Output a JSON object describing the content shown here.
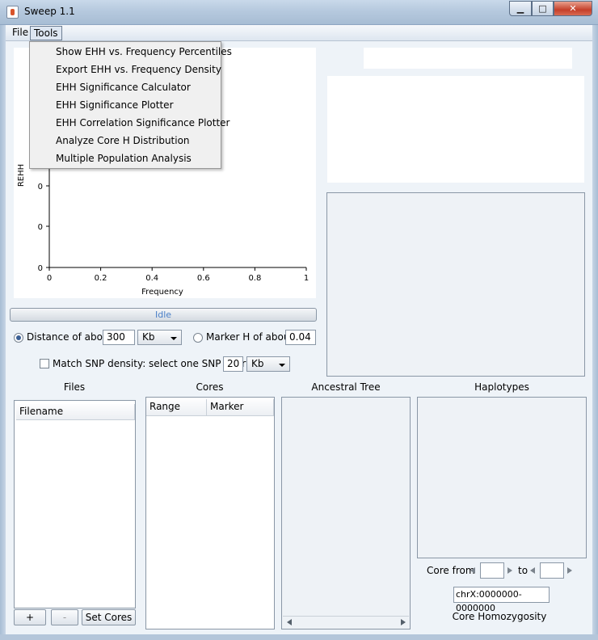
{
  "window": {
    "title": "Sweep 1.1",
    "min": "▁",
    "max": "□",
    "close": "✕"
  },
  "menubar": {
    "file": "File",
    "tools": "Tools"
  },
  "tools_menu": {
    "items": [
      "Show EHH vs. Frequency Percentiles",
      "Export EHH vs. Frequency Density",
      "EHH Significance Calculator",
      "EHH Significance Plotter",
      "EHH Correlation Significance Plotter",
      "Analyze Core H Distribution",
      "Multiple Population Analysis"
    ]
  },
  "chart_data": {
    "type": "scatter",
    "xlabel": "Frequency",
    "ylabel": "REHH",
    "xlim": [
      0,
      1
    ],
    "x_ticks": [
      "0",
      "0.2",
      "0.4",
      "0.6",
      "0.8",
      "1"
    ],
    "y_ticks_visible": [
      "0",
      "0",
      "0"
    ],
    "series": []
  },
  "status": {
    "text": "Idle"
  },
  "options": {
    "distance_label": "Distance of about",
    "distance_value": "300",
    "distance_unit": "Kb",
    "marker_h_label": "Marker H of about",
    "marker_h_value": "0.04",
    "match_snp_label": "Match SNP density: select one SNP every",
    "match_snp_value": "20",
    "match_snp_unit": "Kb"
  },
  "sections": {
    "files": "Files",
    "cores": "Cores",
    "ancestral_tree": "Ancestral Tree",
    "haplotypes": "Haplotypes"
  },
  "files_table": {
    "header": "Filename"
  },
  "cores_table": {
    "col_range": "Range",
    "col_marker": "Marker"
  },
  "buttons": {
    "add": "+",
    "remove": "-",
    "set_cores": "Set Cores"
  },
  "core_controls": {
    "core_from": "Core from",
    "to": "to",
    "region": "chrX:0000000-0000000",
    "core_homozygosity": "Core Homozygosity"
  },
  "colors": {
    "accent": "#4a7fc8",
    "close": "#c5402a"
  }
}
